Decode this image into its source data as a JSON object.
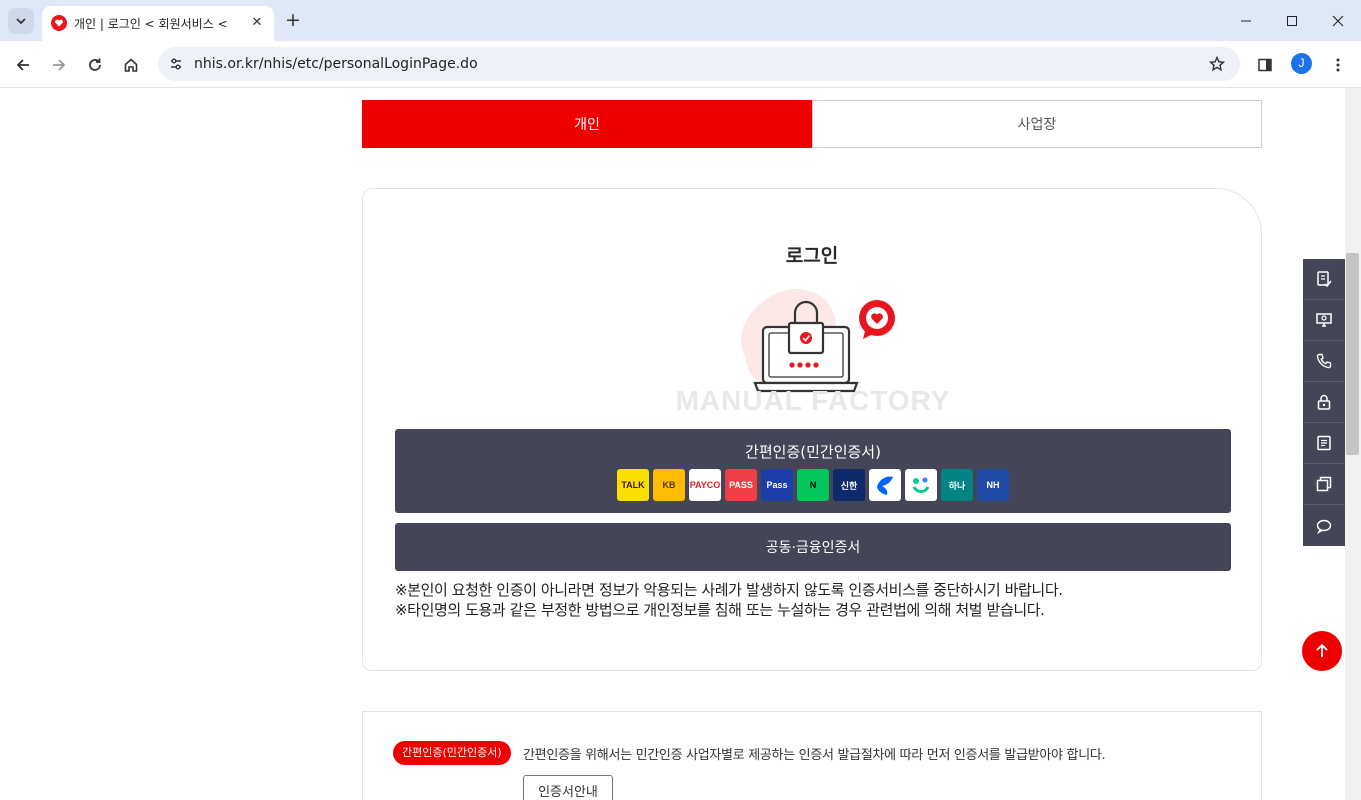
{
  "browser": {
    "tab_title": "개인 | 로그인 < 회원서비스 < ",
    "url": "nhis.or.kr/nhis/etc/personalLoginPage.do",
    "profile_initial": "J",
    "icons": [
      "tab-list-icon",
      "favicon-heart-icon",
      "close-icon",
      "plus-icon",
      "minimize-icon",
      "maximize-icon",
      "close-window-icon",
      "back-icon",
      "forward-icon",
      "reload-icon",
      "home-icon",
      "site-info-icon",
      "star-icon",
      "side-panel-icon",
      "more-icon"
    ]
  },
  "tabs": {
    "personal": "개인",
    "business": "사업장"
  },
  "login": {
    "title": "로그인",
    "watermark": "MANUAL FACTORY",
    "simple_auth_label": "간편인증(민간인증서)",
    "joint_auth_label": "공동·금융인증서",
    "providers": [
      {
        "name": "kakao",
        "label": "TALK",
        "bg": "#f9e000",
        "fg": "#3a1d1d"
      },
      {
        "name": "kb",
        "label": "KB",
        "bg": "#ffbc00",
        "fg": "#4a3b2b"
      },
      {
        "name": "payco",
        "label": "PAYCO",
        "bg": "#ffffff",
        "fg": "#ee1c24"
      },
      {
        "name": "pass",
        "label": "PASS",
        "bg": "#ef3e45",
        "fg": "#ffffff"
      },
      {
        "name": "samsung-pass",
        "label": "Pass",
        "bg": "#1c3ea8",
        "fg": "#ffffff"
      },
      {
        "name": "naver",
        "label": "N",
        "bg": "#03c75a",
        "fg": "#000000"
      },
      {
        "name": "shinhan",
        "label": "신한",
        "bg": "#0d2a6b",
        "fg": "#ffffff"
      },
      {
        "name": "toss",
        "label": "",
        "bg": "#ffffff",
        "fg": "#0064ff"
      },
      {
        "name": "banksalad",
        "label": "",
        "bg": "#ffffff",
        "fg": "#00c896"
      },
      {
        "name": "hana",
        "label": "하나",
        "bg": "#008485",
        "fg": "#ffffff"
      },
      {
        "name": "nh",
        "label": "NH",
        "bg": "#1f4aa8",
        "fg": "#ffffff"
      }
    ],
    "notices": [
      "※본인이 요청한 인증이 아니라면 정보가 악용되는 사례가 발생하지 않도록 인증서비스를 중단하시기 바랍니다.",
      "※타인명의 도용과 같은 부정한 방법으로 개인정보를 침해 또는 누설하는 경우 관련법에 의해 처벌 받습니다."
    ]
  },
  "info": {
    "badge": "간편인증(민간인증서)",
    "text": "간편인증을 위해서는 민간인증 사업자별로 제공하는 인증서 발급절차에 따라 먼저 인증서를 발급받아야 합니다.",
    "button": "인증서안내"
  },
  "quick_menu": [
    "document-check-icon",
    "monitor-icon",
    "phone-icon",
    "lock-icon",
    "list-icon",
    "window-icon",
    "chat-icon"
  ],
  "colors": {
    "accent": "#ee0000",
    "dark_button": "#444556"
  }
}
